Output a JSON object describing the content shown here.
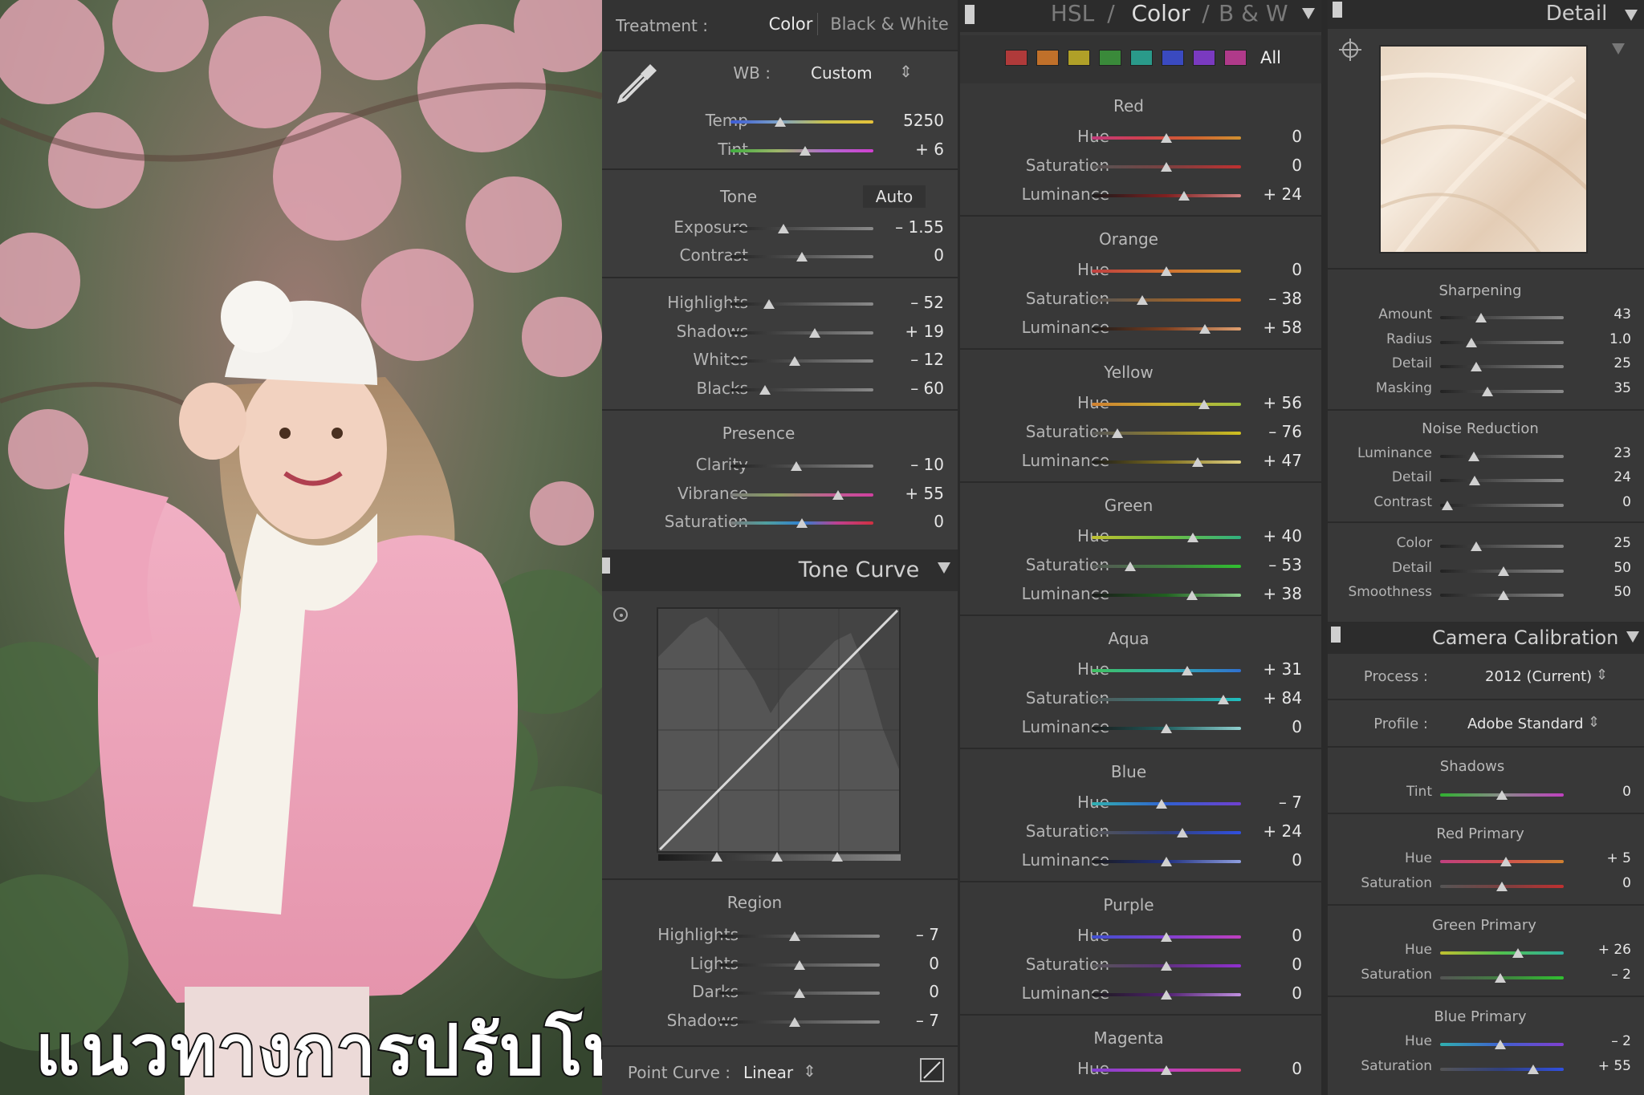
{
  "overlay_text": "แนวทางการปรับโทน",
  "basic": {
    "treatment_label": "Treatment :",
    "treatment_color": "Color",
    "treatment_bw": "Black & White",
    "wb_label": "WB :",
    "wb_value": "Custom",
    "temp": {
      "label": "Temp",
      "value": "5250",
      "pos": 0.35
    },
    "tint": {
      "label": "Tint",
      "value": "+ 6",
      "pos": 0.52
    },
    "tone_title": "Tone",
    "auto_label": "Auto",
    "exposure": {
      "label": "Exposure",
      "value": "– 1.55",
      "pos": 0.37
    },
    "contrast": {
      "label": "Contrast",
      "value": "0",
      "pos": 0.5
    },
    "highlights": {
      "label": "Highlights",
      "value": "– 52",
      "pos": 0.27
    },
    "shadows": {
      "label": "Shadows",
      "value": "+ 19",
      "pos": 0.59
    },
    "whites": {
      "label": "Whites",
      "value": "– 12",
      "pos": 0.45
    },
    "blacks": {
      "label": "Blacks",
      "value": "– 60",
      "pos": 0.24
    },
    "presence_title": "Presence",
    "clarity": {
      "label": "Clarity",
      "value": "– 10",
      "pos": 0.46
    },
    "vibrance": {
      "label": "Vibrance",
      "value": "+ 55",
      "pos": 0.75
    },
    "saturation": {
      "label": "Saturation",
      "value": "0",
      "pos": 0.5
    }
  },
  "tone_curve": {
    "title": "Tone Curve",
    "region_title": "Region",
    "highlights": {
      "label": "Highlights",
      "value": "– 7",
      "pos": 0.47
    },
    "lights": {
      "label": "Lights",
      "value": "0",
      "pos": 0.5
    },
    "darks": {
      "label": "Darks",
      "value": "0",
      "pos": 0.5
    },
    "shadows": {
      "label": "Shadows",
      "value": "– 7",
      "pos": 0.47
    },
    "point_curve_label": "Point Curve :",
    "point_curve_value": "Linear"
  },
  "hsl": {
    "tab_hsl": "HSL",
    "tab_color": "Color",
    "tab_bw": "B & W",
    "sep": "/",
    "all_label": "All",
    "swatches": [
      "#b03a3a",
      "#c0702a",
      "#b0a028",
      "#3a8a3a",
      "#2a9a8a",
      "#3a4ac0",
      "#7a3ac0",
      "#b03a8a"
    ],
    "groups": [
      {
        "name": "Red",
        "rows": [
          {
            "label": "Hue",
            "value": "0",
            "pos": 0.5
          },
          {
            "label": "Saturation",
            "value": "0",
            "pos": 0.5
          },
          {
            "label": "Luminance",
            "value": "+ 24",
            "pos": 0.62
          }
        ]
      },
      {
        "name": "Orange",
        "rows": [
          {
            "label": "Hue",
            "value": "0",
            "pos": 0.5
          },
          {
            "label": "Saturation",
            "value": "– 38",
            "pos": 0.34
          },
          {
            "label": "Luminance",
            "value": "+ 58",
            "pos": 0.76
          }
        ]
      },
      {
        "name": "Yellow",
        "rows": [
          {
            "label": "Hue",
            "value": "+ 56",
            "pos": 0.75
          },
          {
            "label": "Saturation",
            "value": "– 76",
            "pos": 0.17
          },
          {
            "label": "Luminance",
            "value": "+ 47",
            "pos": 0.71
          }
        ]
      },
      {
        "name": "Green",
        "rows": [
          {
            "label": "Hue",
            "value": "+ 40",
            "pos": 0.68
          },
          {
            "label": "Saturation",
            "value": "– 53",
            "pos": 0.26
          },
          {
            "label": "Luminance",
            "value": "+ 38",
            "pos": 0.67
          }
        ]
      },
      {
        "name": "Aqua",
        "rows": [
          {
            "label": "Hue",
            "value": "+ 31",
            "pos": 0.64
          },
          {
            "label": "Saturation",
            "value": "+ 84",
            "pos": 0.88
          },
          {
            "label": "Luminance",
            "value": "0",
            "pos": 0.5
          }
        ]
      },
      {
        "name": "Blue",
        "rows": [
          {
            "label": "Hue",
            "value": "– 7",
            "pos": 0.47
          },
          {
            "label": "Saturation",
            "value": "+ 24",
            "pos": 0.61
          },
          {
            "label": "Luminance",
            "value": "0",
            "pos": 0.5
          }
        ]
      },
      {
        "name": "Purple",
        "rows": [
          {
            "label": "Hue",
            "value": "0",
            "pos": 0.5
          },
          {
            "label": "Saturation",
            "value": "0",
            "pos": 0.5
          },
          {
            "label": "Luminance",
            "value": "0",
            "pos": 0.5
          }
        ]
      },
      {
        "name": "Magenta",
        "rows": [
          {
            "label": "Hue",
            "value": "0",
            "pos": 0.5
          }
        ]
      }
    ]
  },
  "detail": {
    "title": "Detail",
    "sharpening_title": "Sharpening",
    "amount": {
      "label": "Amount",
      "value": "43",
      "pos": 0.33
    },
    "radius": {
      "label": "Radius",
      "value": "1.0",
      "pos": 0.25
    },
    "detail": {
      "label": "Detail",
      "value": "25",
      "pos": 0.29
    },
    "masking": {
      "label": "Masking",
      "value": "35",
      "pos": 0.38
    },
    "noise_title": "Noise Reduction",
    "nr_luminance": {
      "label": "Luminance",
      "value": "23",
      "pos": 0.27
    },
    "nr_detail": {
      "label": "Detail",
      "value": "24",
      "pos": 0.28
    },
    "nr_contrast": {
      "label": "Contrast",
      "value": "0",
      "pos": 0.06
    },
    "nr_color": {
      "label": "Color",
      "value": "25",
      "pos": 0.29
    },
    "nr_color_detail": {
      "label": "Detail",
      "value": "50",
      "pos": 0.51
    },
    "nr_smoothness": {
      "label": "Smoothness",
      "value": "50",
      "pos": 0.51
    }
  },
  "calibration": {
    "title": "Camera Calibration",
    "process_label": "Process :",
    "process_value": "2012 (Current)",
    "profile_label": "Profile :",
    "profile_value": "Adobe Standard",
    "shadows_title": "Shadows",
    "shadows_tint": {
      "label": "Tint",
      "value": "0",
      "pos": 0.5
    },
    "red_title": "Red Primary",
    "red_hue": {
      "label": "Hue",
      "value": "+ 5",
      "pos": 0.53
    },
    "red_sat": {
      "label": "Saturation",
      "value": "0",
      "pos": 0.5
    },
    "green_title": "Green Primary",
    "green_hue": {
      "label": "Hue",
      "value": "+ 26",
      "pos": 0.63
    },
    "green_sat": {
      "label": "Saturation",
      "value": "– 2",
      "pos": 0.49
    },
    "blue_title": "Blue Primary",
    "blue_hue": {
      "label": "Hue",
      "value": "– 2",
      "pos": 0.49
    },
    "blue_sat": {
      "label": "Saturation",
      "value": "+ 55",
      "pos": 0.75
    }
  }
}
